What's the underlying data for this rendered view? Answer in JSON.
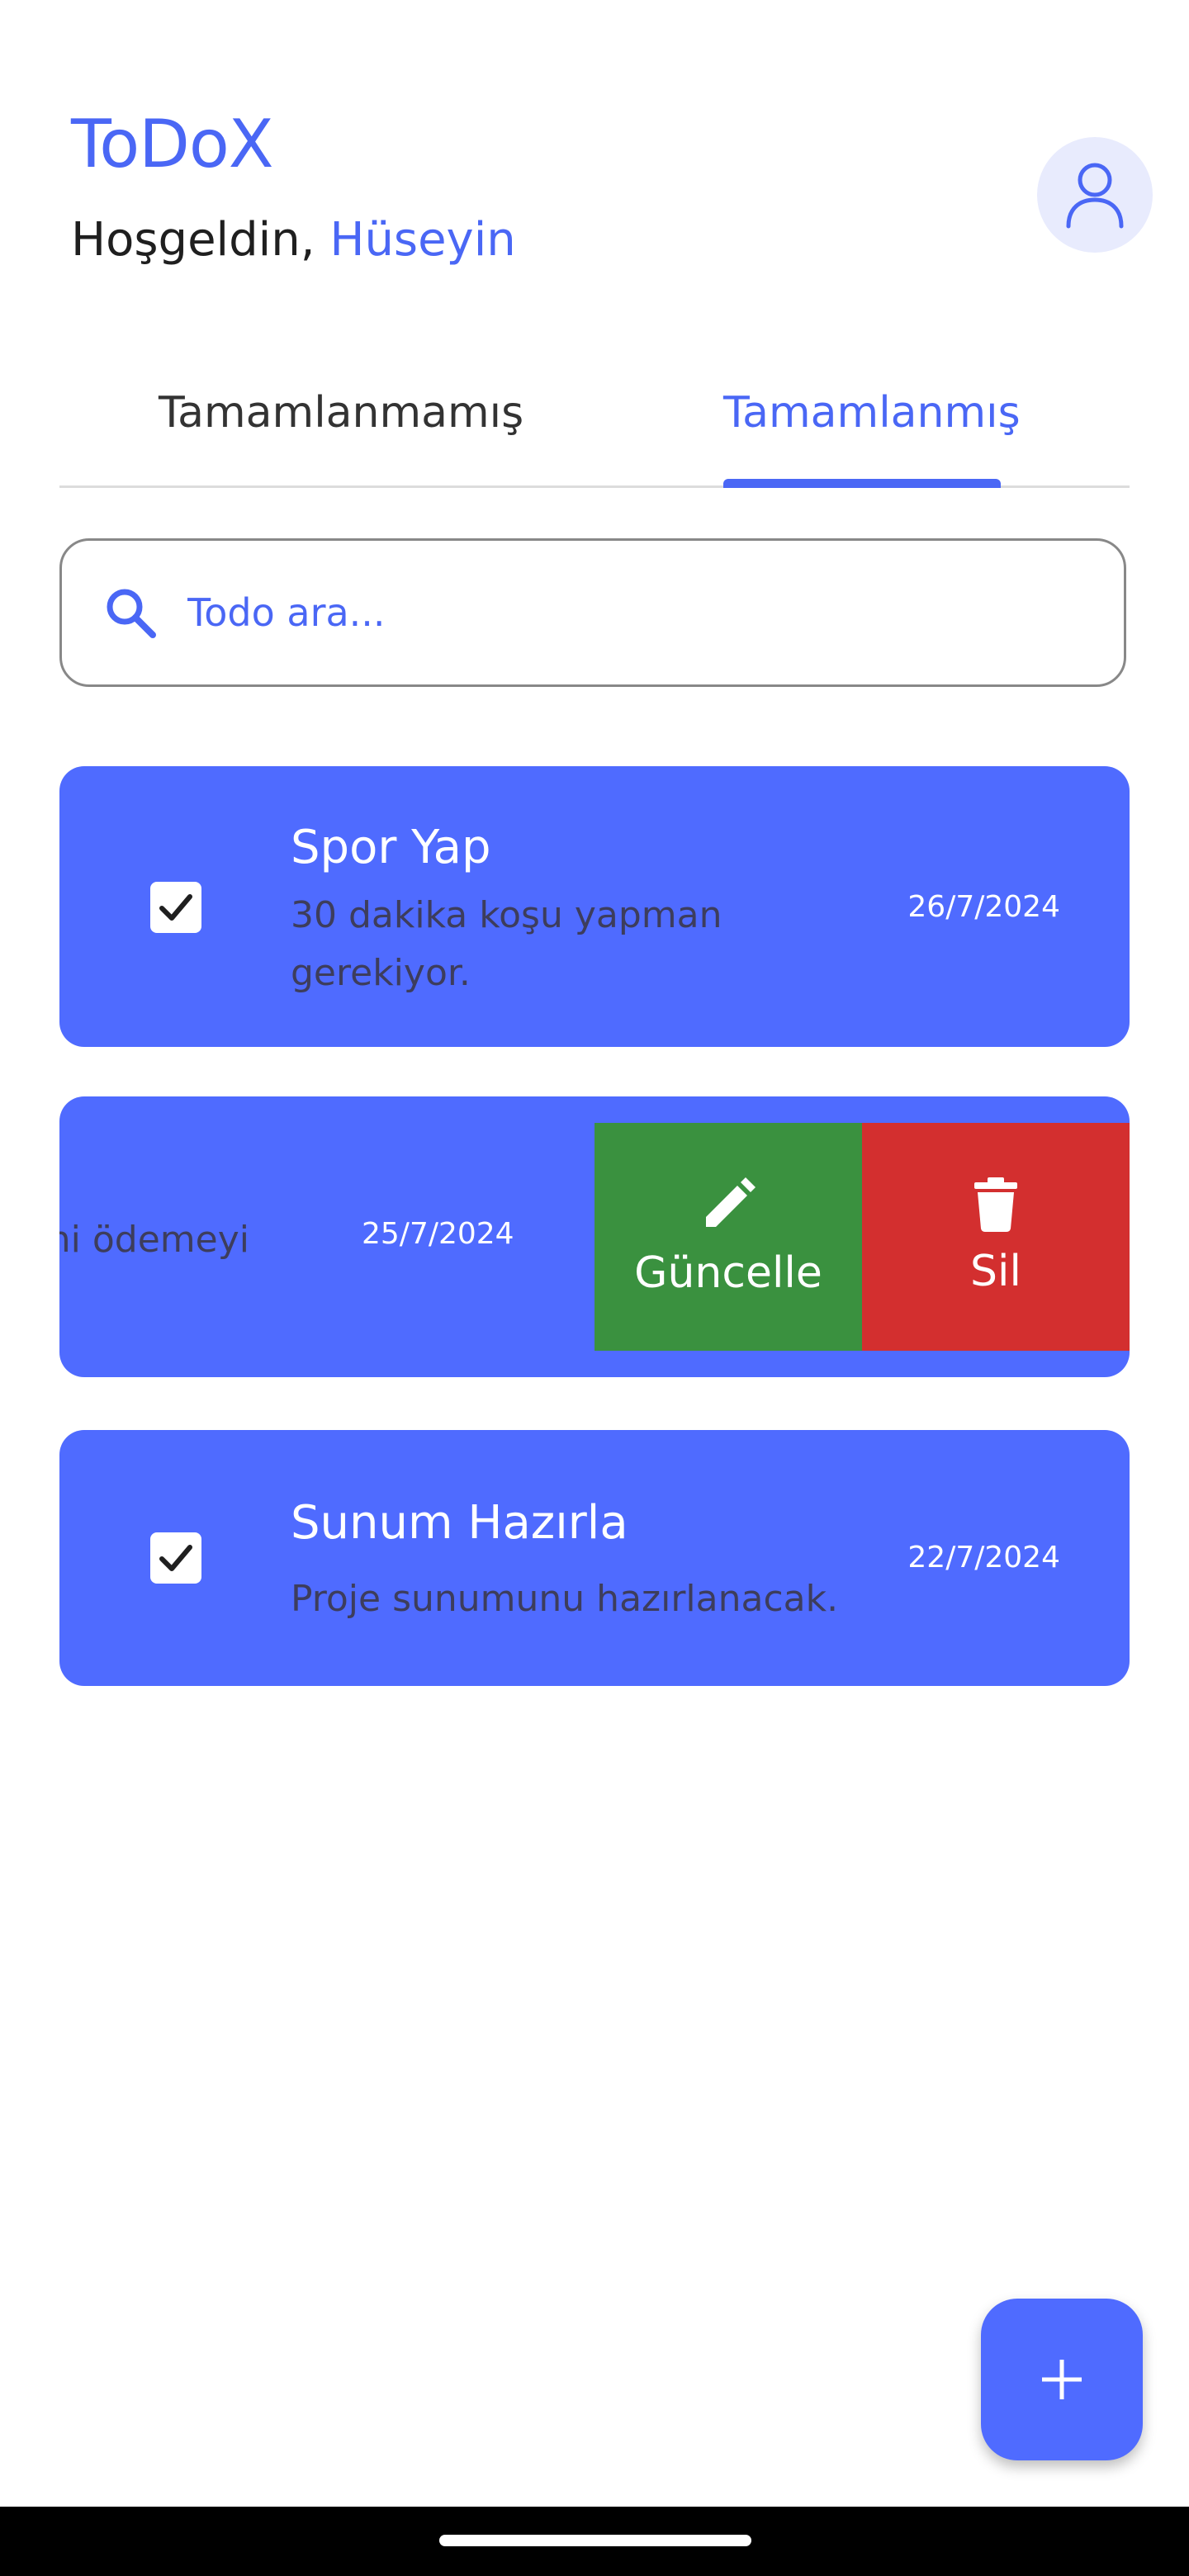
{
  "header": {
    "app_title": "ToDoX",
    "greeting_prefix": "Hoşgeldin,",
    "user_name": "Hüseyin",
    "avatar_icon": "person-outline-icon"
  },
  "tabs": [
    {
      "label": "Tamamlanmamış",
      "selected": false
    },
    {
      "label": "Tamamlanmış",
      "selected": true
    }
  ],
  "search": {
    "placeholder": "Todo ara...",
    "value": "",
    "icon": "search-icon"
  },
  "todos": [
    {
      "title": "Spor Yap",
      "description": "30 dakika koşu yapman gerekiyor.",
      "date": "26/7/2024",
      "completed": true
    },
    {
      "title": "",
      "description_visible": "ni ödemeyi",
      "date": "25/7/2024",
      "completed": true,
      "swiped": true
    },
    {
      "title": "Sunum Hazırla",
      "description": "Proje sunumunu hazırlanacak.",
      "date": "22/7/2024",
      "completed": true
    }
  ],
  "swipe_actions": {
    "update_label": "Güncelle",
    "update_icon": "pencil-icon",
    "delete_label": "Sil",
    "delete_icon": "trash-icon"
  },
  "fab": {
    "icon": "plus-icon"
  },
  "colors": {
    "primary": "#4f6bff",
    "accent_text": "#4a67f5",
    "update": "#3a913f",
    "delete": "#d32f2f"
  }
}
